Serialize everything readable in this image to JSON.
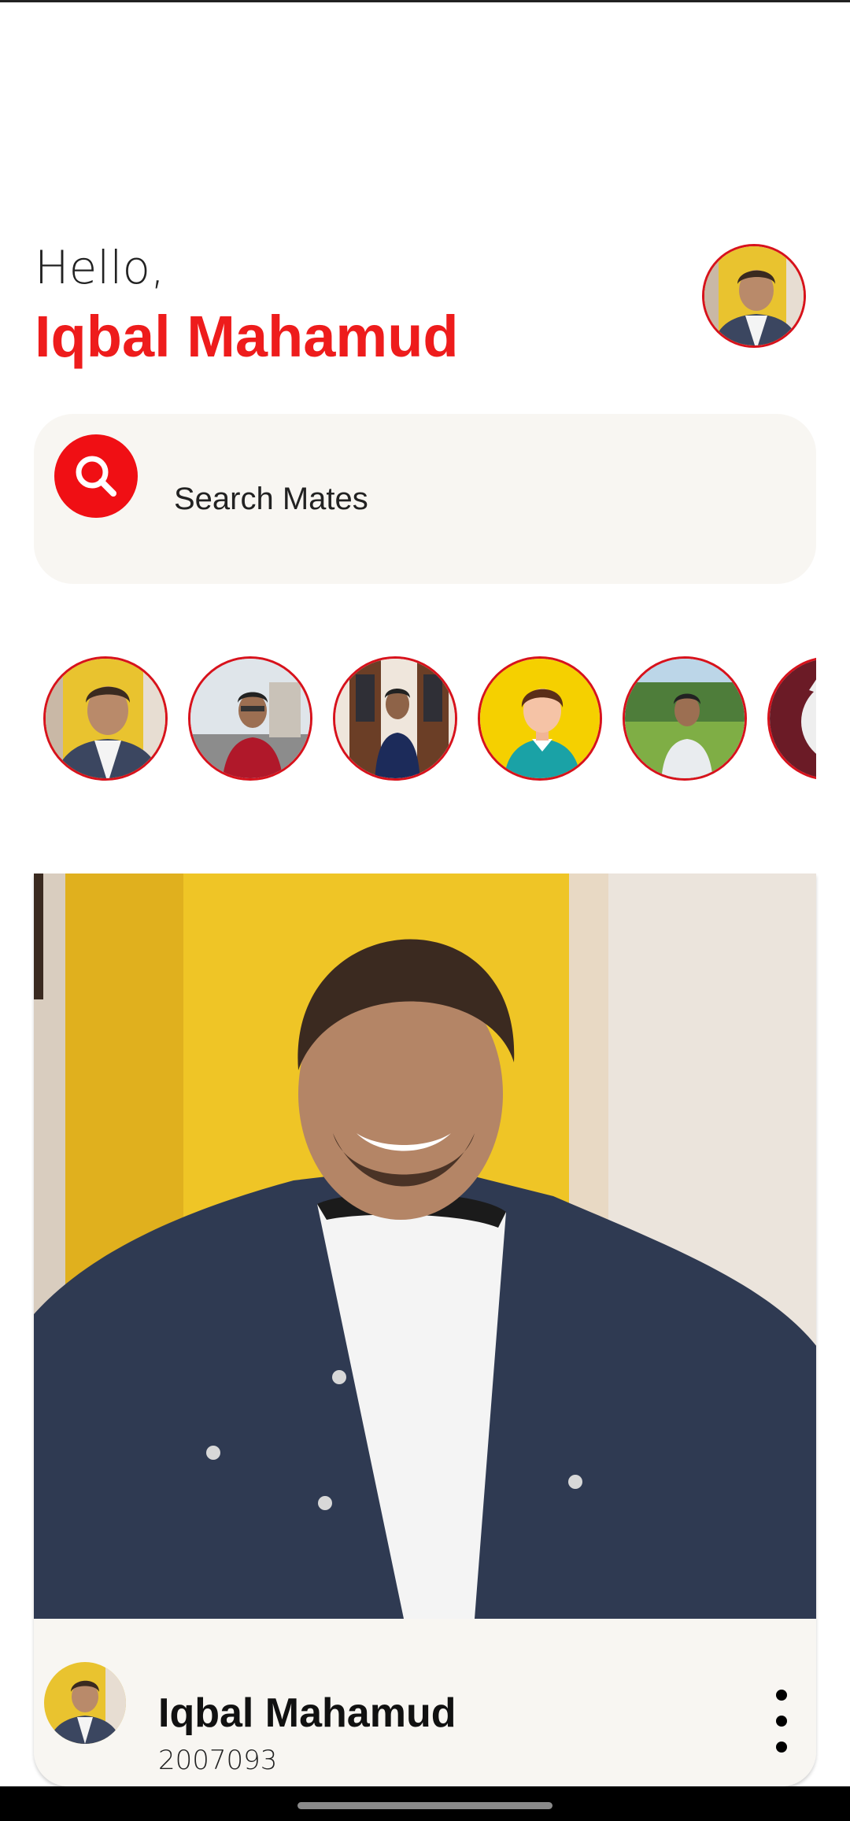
{
  "header": {
    "greeting": "Hello,",
    "user_name": "Iqbal Mahamud"
  },
  "search": {
    "label": "Search Mates",
    "icon": "search-icon"
  },
  "mates": [
    {
      "name": "mate-1",
      "kind": "photo"
    },
    {
      "name": "mate-2",
      "kind": "photo"
    },
    {
      "name": "mate-3",
      "kind": "photo"
    },
    {
      "name": "mate-4",
      "kind": "default-avatar"
    },
    {
      "name": "mate-5",
      "kind": "photo"
    },
    {
      "name": "mate-6",
      "kind": "photo"
    }
  ],
  "post": {
    "author_name": "Iqbal Mahamud",
    "author_id": "2007093",
    "menu_icon": "more-vert-icon"
  },
  "colors": {
    "accent": "#ee1c1c",
    "card_bg": "#f8f6f2"
  }
}
